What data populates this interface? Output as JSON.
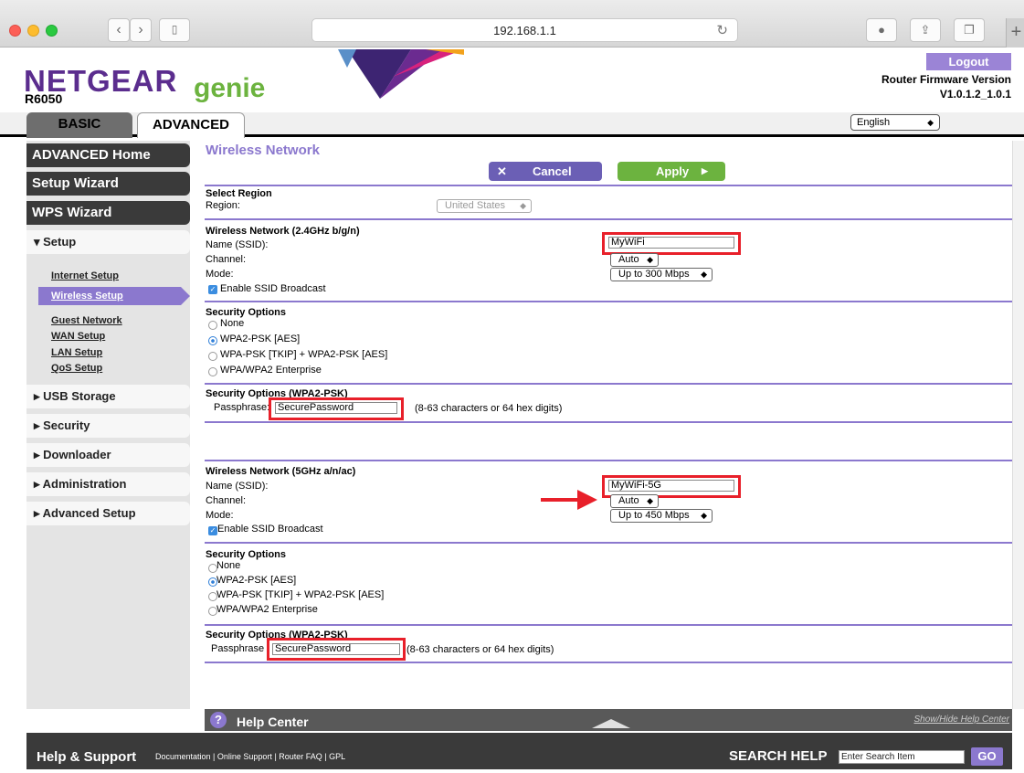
{
  "browser": {
    "address": "192.168.1.1"
  },
  "header": {
    "brand": "NETGEAR",
    "brand_suffix": "genie",
    "model": "R6050",
    "logout": "Logout",
    "firmware_label": "Router Firmware Version",
    "firmware_version": "V1.0.1.2_1.0.1",
    "language": "English"
  },
  "tabs": {
    "basic": "BASIC",
    "advanced": "ADVANCED"
  },
  "sidebar": {
    "advanced_home": "ADVANCED Home",
    "setup_wizard": "Setup Wizard",
    "wps_wizard": "WPS Wizard",
    "setup": "▾ Setup",
    "internet_setup": "Internet Setup",
    "wireless_setup": "Wireless Setup",
    "guest_network": "Guest Network",
    "wan_setup": "WAN Setup",
    "lan_setup": "LAN Setup",
    "qos_setup": "QoS Setup",
    "usb_storage": "▸ USB Storage",
    "security": "▸ Security",
    "downloader": "▸ Downloader",
    "administration": "▸ Administration",
    "advanced_setup": "▸ Advanced Setup"
  },
  "main": {
    "title": "Wireless Network",
    "cancel": "Cancel",
    "apply": "Apply",
    "region": {
      "heading": "Select Region",
      "label": "Region:",
      "value": "United States"
    },
    "wifi24": {
      "heading": "Wireless Network (2.4GHz b/g/n)",
      "name_label": "Name (SSID):",
      "name_value": "MyWiFi",
      "channel_label": "Channel:",
      "channel_value": "Auto",
      "mode_label": "Mode:",
      "mode_value": "Up to 300 Mbps",
      "broadcast": "Enable SSID Broadcast"
    },
    "security24": {
      "heading": "Security Options",
      "opt_none": "None",
      "opt_wpa2": "WPA2-PSK [AES]",
      "opt_mixed": "WPA-PSK [TKIP] + WPA2-PSK [AES]",
      "opt_enterprise": "WPA/WPA2 Enterprise"
    },
    "pass24": {
      "heading": "Security Options (WPA2-PSK)",
      "label": "Passphrase:",
      "value": "SecurePassword",
      "hint": "(8-63 characters or 64 hex digits)"
    },
    "wifi5": {
      "heading": "Wireless Network (5GHz a/n/ac)",
      "name_label": "Name (SSID):",
      "name_value": "MyWiFi-5G",
      "channel_label": "Channel:",
      "channel_value": "Auto",
      "mode_label": "Mode:",
      "mode_value": "Up to 450 Mbps",
      "broadcast": "Enable SSID Broadcast"
    },
    "security5": {
      "heading": "Security Options",
      "opt_none": "None",
      "opt_wpa2": "WPA2-PSK [AES]",
      "opt_mixed": "WPA-PSK [TKIP] + WPA2-PSK [AES]",
      "opt_enterprise": "WPA/WPA2 Enterprise"
    },
    "pass5": {
      "heading": "Security Options (WPA2-PSK)",
      "label": "Passphrase",
      "value": "SecurePassword",
      "hint": "(8-63 characters or 64 hex digits)"
    }
  },
  "help": {
    "title": "Help Center",
    "toggle": "Show/Hide Help Center"
  },
  "footer": {
    "title": "Help & Support",
    "links": [
      "Documentation",
      "Online Support",
      "Router FAQ",
      "GPL"
    ],
    "search_label": "SEARCH HELP",
    "search_placeholder": "Enter Search Item",
    "go": "GO"
  },
  "colors": {
    "accent": "#8b78ce",
    "brand_purple": "#5b2d8e",
    "genie_green": "#6cb33f",
    "annotation_red": "#e8202a"
  }
}
